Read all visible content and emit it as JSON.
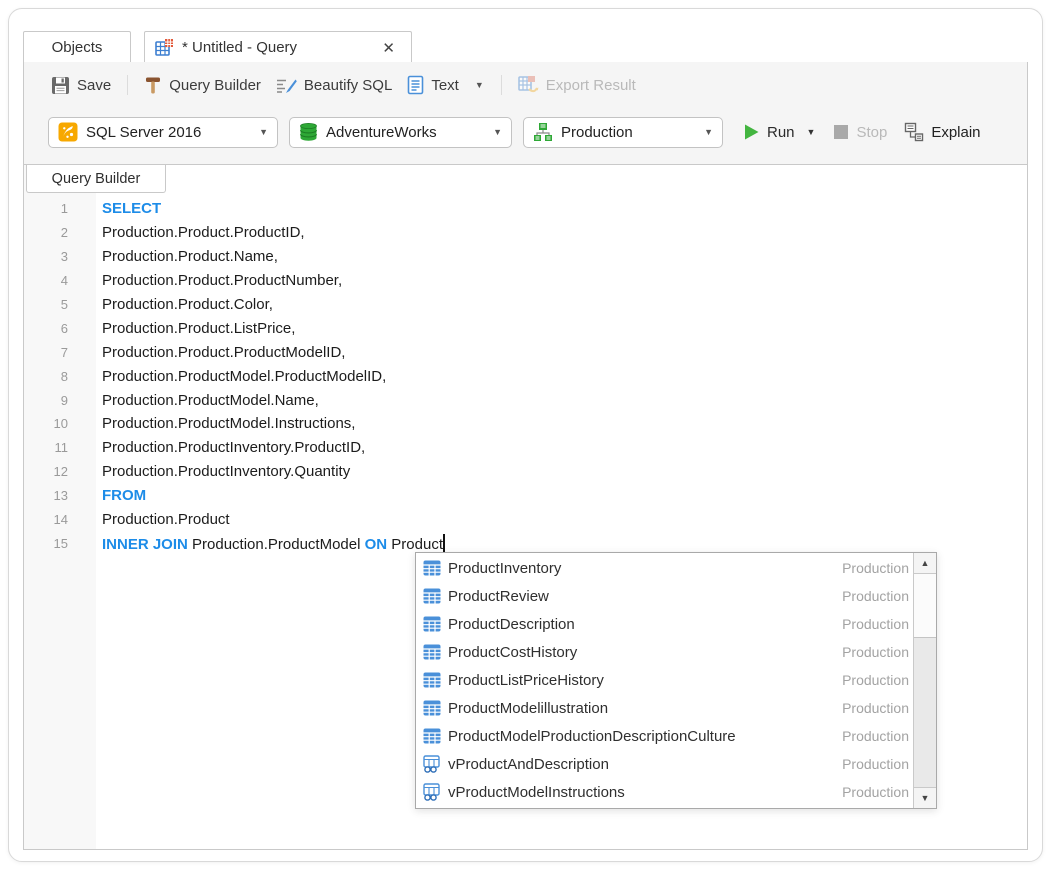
{
  "tabs": {
    "objects_label": "Objects",
    "query_label": "* Untitled - Query",
    "close_glyph": "✕"
  },
  "toolbar": {
    "save": "Save",
    "query_builder": "Query Builder",
    "beautify_sql": "Beautify SQL",
    "text": "Text",
    "export_result": "Export Result"
  },
  "connection": {
    "server": "SQL Server 2016",
    "database": "AdventureWorks",
    "schema": "Production",
    "run": "Run",
    "stop": "Stop",
    "explain": "Explain"
  },
  "editor": {
    "tab_label": "Query Builder",
    "lines": [
      {
        "n": "1",
        "parts": [
          {
            "t": "SELECT",
            "k": true
          }
        ]
      },
      {
        "n": "2",
        "parts": [
          {
            "t": "Production.Product.ProductID,"
          }
        ]
      },
      {
        "n": "3",
        "parts": [
          {
            "t": "Production.Product.Name,"
          }
        ]
      },
      {
        "n": "4",
        "parts": [
          {
            "t": "Production.Product.ProductNumber,"
          }
        ]
      },
      {
        "n": "5",
        "parts": [
          {
            "t": "Production.Product.Color,"
          }
        ]
      },
      {
        "n": "6",
        "parts": [
          {
            "t": "Production.Product.ListPrice,"
          }
        ]
      },
      {
        "n": "7",
        "parts": [
          {
            "t": "Production.Product.ProductModelID,"
          }
        ]
      },
      {
        "n": "8",
        "parts": [
          {
            "t": "Production.ProductModel.ProductModelID,"
          }
        ]
      },
      {
        "n": "9",
        "parts": [
          {
            "t": "Production.ProductModel.Name,"
          }
        ]
      },
      {
        "n": "10",
        "parts": [
          {
            "t": "Production.ProductModel.Instructions,"
          }
        ]
      },
      {
        "n": "11",
        "parts": [
          {
            "t": "Production.ProductInventory.ProductID,"
          }
        ]
      },
      {
        "n": "12",
        "parts": [
          {
            "t": "Production.ProductInventory.Quantity"
          }
        ]
      },
      {
        "n": "13",
        "parts": [
          {
            "t": "FROM",
            "k": true
          }
        ]
      },
      {
        "n": "14",
        "parts": [
          {
            "t": "Production.Product"
          }
        ]
      },
      {
        "n": "15",
        "parts": [
          {
            "t": "INNER JOIN ",
            "k": true
          },
          {
            "t": "Production.ProductModel "
          },
          {
            "t": "ON ",
            "k": true
          },
          {
            "t": "Product"
          }
        ],
        "cursor": true
      }
    ]
  },
  "autocomplete": {
    "items": [
      {
        "name": "ProductInventory",
        "schema": "Production",
        "icon": "table-icon"
      },
      {
        "name": "ProductReview",
        "schema": "Production",
        "icon": "table-icon"
      },
      {
        "name": "ProductDescription",
        "schema": "Production",
        "icon": "table-icon"
      },
      {
        "name": "ProductCostHistory",
        "schema": "Production",
        "icon": "table-icon"
      },
      {
        "name": "ProductListPriceHistory",
        "schema": "Production",
        "icon": "table-icon"
      },
      {
        "name": "ProductModelillustration",
        "schema": "Production",
        "icon": "table-icon"
      },
      {
        "name": "ProductModelProductionDescriptionCulture",
        "schema": "Production",
        "icon": "table-icon"
      },
      {
        "name": "vProductAndDescription",
        "schema": "Production",
        "icon": "view-icon"
      },
      {
        "name": "vProductModelInstructions",
        "schema": "Production",
        "icon": "view-icon"
      }
    ],
    "scroll_up_glyph": "▲",
    "scroll_down_glyph": "▼"
  },
  "glyphs": {
    "dropdown_caret": "▼"
  },
  "colors": {
    "keyword_blue": "#1d8ce8",
    "run_green": "#43b540",
    "db_green": "#2ea836",
    "server_orange": "#f7a800",
    "table_icon_blue": "#4a90d9",
    "disabled_gray": "#b9b9b9",
    "toolbar_band": "#f5f5f5"
  }
}
